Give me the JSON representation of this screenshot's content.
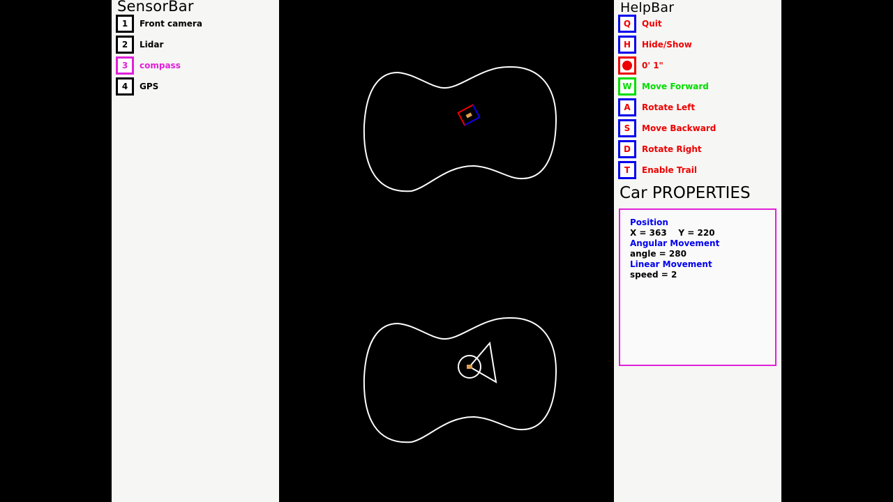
{
  "sensor_bar": {
    "title": "SensorBar",
    "items": [
      {
        "key": "1",
        "label": "Front camera",
        "color": "#000000"
      },
      {
        "key": "2",
        "label": "Lidar",
        "color": "#000000"
      },
      {
        "key": "3",
        "label": "compass",
        "color": "#e020d8"
      },
      {
        "key": "4",
        "label": "GPS",
        "color": "#000000"
      }
    ]
  },
  "help_bar": {
    "title": "HelpBar",
    "items": [
      {
        "key": "Q",
        "label": "Quit",
        "border": "#0000ee",
        "color": "#ee0000"
      },
      {
        "key": "H",
        "label": "Hide/Show",
        "border": "#0000ee",
        "color": "#ee0000"
      },
      {
        "key": "",
        "icon": "record-icon",
        "label": "0' 1\"",
        "border": "#ee0000",
        "color": "#ee0000"
      },
      {
        "key": "W",
        "label": "Move Forward",
        "border": "#00dd00",
        "color": "#00dd00"
      },
      {
        "key": "A",
        "label": "Rotate Left",
        "border": "#0000ee",
        "color": "#ee0000"
      },
      {
        "key": "S",
        "label": "Move Backward",
        "border": "#0000ee",
        "color": "#ee0000"
      },
      {
        "key": "D",
        "label": "Rotate Right",
        "border": "#0000ee",
        "color": "#ee0000"
      },
      {
        "key": "T",
        "label": "Enable Trail",
        "border": "#0000ee",
        "color": "#ee0000"
      }
    ]
  },
  "car_properties": {
    "title": "Car PROPERTIES",
    "position_heading": "Position",
    "position_value": "X = 363    Y = 220",
    "angular_heading": "Angular Movement",
    "angular_value": "angle = 280",
    "linear_heading": "Linear Movement",
    "linear_value": "speed = 2"
  },
  "colors": {
    "panel_bg": "#f6f6f4",
    "viewport_bg": "#000000",
    "track": "#ffffff",
    "accent": "#e020d8"
  }
}
